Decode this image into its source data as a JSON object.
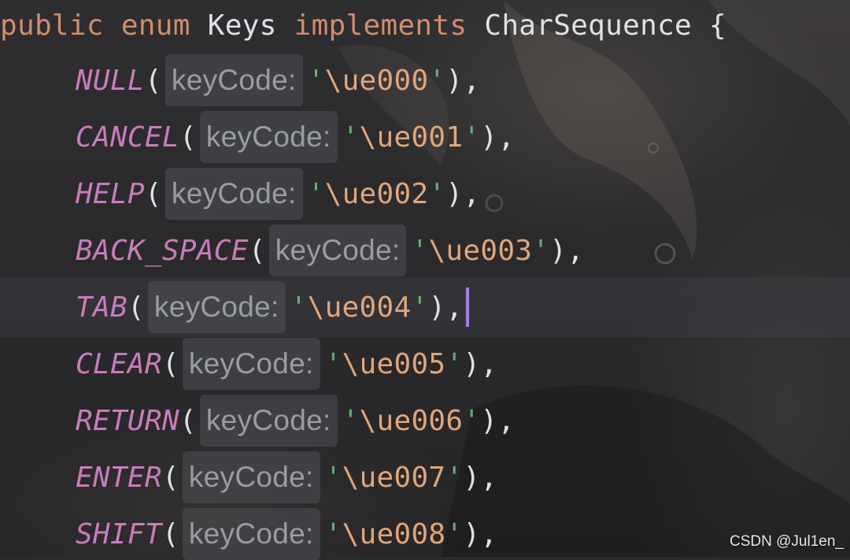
{
  "declaration": {
    "modifier": "public",
    "keyword": "enum",
    "name": "Keys",
    "implements_kw": "implements",
    "interface": "CharSequence",
    "open_brace": "{"
  },
  "hint_label": "keyCode:",
  "entries": [
    {
      "name": "NULL",
      "value": "\\ue000"
    },
    {
      "name": "CANCEL",
      "value": "\\ue001"
    },
    {
      "name": "HELP",
      "value": "\\ue002"
    },
    {
      "name": "BACK_SPACE",
      "value": "\\ue003"
    },
    {
      "name": "TAB",
      "value": "\\ue004"
    },
    {
      "name": "CLEAR",
      "value": "\\ue005"
    },
    {
      "name": "RETURN",
      "value": "\\ue006"
    },
    {
      "name": "ENTER",
      "value": "\\ue007"
    },
    {
      "name": "SHIFT",
      "value": "\\ue008"
    }
  ],
  "cursor_entry_index": 4,
  "watermark": "CSDN @Jul1en_",
  "colors": {
    "keyword": "#cf8e6d",
    "enum_constant": "#c77dbb",
    "string": "#dfa67a",
    "quote": "#6aab73",
    "hint": "#9a9ca3",
    "caret": "#a77de0"
  }
}
